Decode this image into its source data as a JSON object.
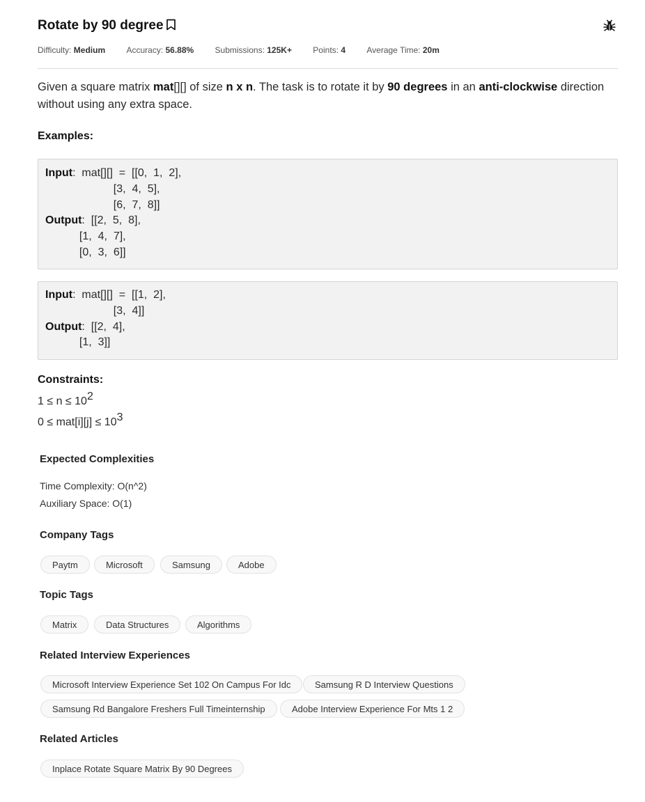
{
  "problem": {
    "title": "Rotate by 90 degree",
    "meta": {
      "difficulty_label": "Difficulty: ",
      "difficulty": "Medium",
      "accuracy_label": "Accuracy: ",
      "accuracy": "56.88%",
      "submissions_label": "Submissions: ",
      "submissions": "125K+",
      "points_label": "Points: ",
      "points": "4",
      "avg_time_label": "Average Time: ",
      "avg_time": "20m"
    },
    "description": {
      "t1": "Given a square matrix ",
      "b1": "mat",
      "t2": "[][] of size ",
      "b2": "n x n",
      "t3": ". The task is to rotate it by ",
      "b3": "90 degrees",
      "t4": " in an ",
      "b4": "anti-clockwise",
      "t5": " direction without using any extra space."
    }
  },
  "examples": {
    "heading": "Examples:",
    "items": [
      {
        "input_label": "Input",
        "input_lines": [
          ":  mat[][]  =  [[0,  1,  2],",
          "                      [3,  4,  5],",
          "                      [6,  7,  8]]"
        ],
        "output_label": "Output",
        "output_lines": [
          ":  [[2,  5,  8],",
          "           [1,  4,  7],",
          "           [0,  3,  6]]"
        ]
      },
      {
        "input_label": "Input",
        "input_lines": [
          ":  mat[][]  =  [[1,  2],",
          "                      [3,  4]]"
        ],
        "output_label": "Output",
        "output_lines": [
          ":  [[2,  4],",
          "           [1,  3]]"
        ]
      }
    ]
  },
  "constraints": {
    "heading": "Constraints:",
    "c1_text": "1 ≤ n ≤ 10",
    "c1_sup": "2",
    "c2_text": "0 ≤ mat[i][j] ≤ 10",
    "c2_sup": "3"
  },
  "complexities": {
    "heading": "Expected Complexities",
    "time": "Time Complexity: O(n^2)",
    "space": "Auxiliary Space: O(1)"
  },
  "company_tags": {
    "heading": "Company Tags",
    "items": [
      "Paytm",
      "Microsoft",
      "Samsung",
      "Adobe"
    ]
  },
  "topic_tags": {
    "heading": "Topic Tags",
    "items": [
      "Matrix",
      "Data Structures",
      "Algorithms"
    ]
  },
  "interview_experiences": {
    "heading": "Related Interview Experiences",
    "items": [
      "Microsoft Interview Experience Set 102 On Campus For Idc",
      "Samsung R D Interview Questions",
      "Samsung Rd Bangalore Freshers Full Timeinternship",
      "Adobe Interview Experience For Mts 1 2"
    ]
  },
  "related_articles": {
    "heading": "Related Articles",
    "items": [
      "Inplace Rotate Square Matrix By 90 Degrees"
    ]
  },
  "icons": {
    "bookmark": "bookmark-icon",
    "bug": "bug-icon"
  }
}
